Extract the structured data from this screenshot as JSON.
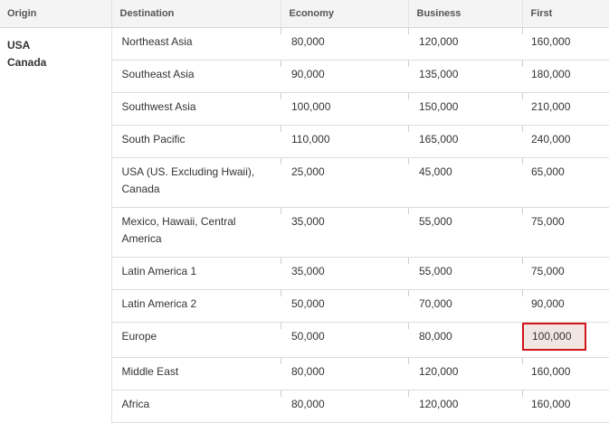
{
  "headers": {
    "origin": "Origin",
    "destination": "Destination",
    "economy": "Economy",
    "business": "Business",
    "first": "First"
  },
  "origin": {
    "line1": "USA",
    "line2": "Canada"
  },
  "rows": [
    {
      "destination": "Northeast Asia",
      "economy": "80,000",
      "business": "120,000",
      "first": "160,000"
    },
    {
      "destination": "Southeast Asia",
      "economy": "90,000",
      "business": "135,000",
      "first": "180,000"
    },
    {
      "destination": "Southwest Asia",
      "economy": "100,000",
      "business": "150,000",
      "first": "210,000"
    },
    {
      "destination": "South Pacific",
      "economy": "110,000",
      "business": "165,000",
      "first": "240,000"
    },
    {
      "destination": "USA (US. Excluding Hwaii), Canada",
      "economy": "25,000",
      "business": "45,000",
      "first": "65,000"
    },
    {
      "destination": "Mexico, Hawaii, Central America",
      "economy": "35,000",
      "business": "55,000",
      "first": "75,000"
    },
    {
      "destination": "Latin America 1",
      "economy": "35,000",
      "business": "55,000",
      "first": "75,000"
    },
    {
      "destination": "Latin America 2",
      "economy": "50,000",
      "business": "70,000",
      "first": "90,000"
    },
    {
      "destination": "Europe",
      "economy": "50,000",
      "business": "80,000",
      "first": "100,000"
    },
    {
      "destination": "Middle East",
      "economy": "80,000",
      "business": "120,000",
      "first": "160,000"
    },
    {
      "destination": "Africa",
      "economy": "80,000",
      "business": "120,000",
      "first": "160,000"
    }
  ],
  "highlight": {
    "row": "Europe",
    "column": "First",
    "border_color": "#d0161b",
    "fill_color": "#f2e6e3"
  }
}
